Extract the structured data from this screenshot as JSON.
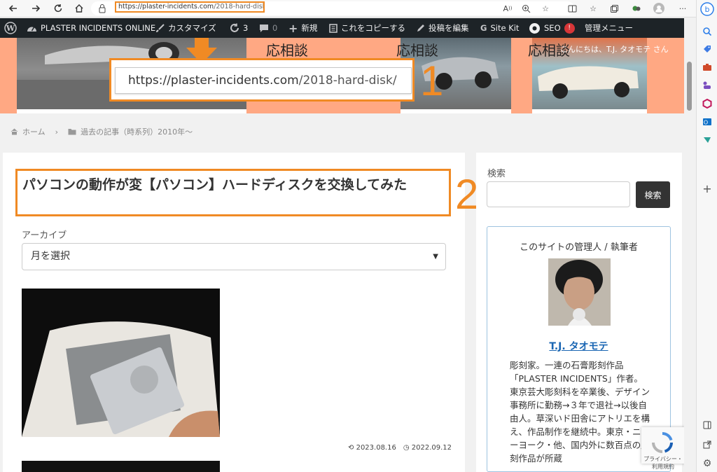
{
  "browser": {
    "url_host": "https://plaster-incidents.com",
    "url_path": "/2018-hard-disk/"
  },
  "admin_bar": {
    "site_name": "PLASTER INCIDENTS ONLINE",
    "customize": "カスタマイズ",
    "updates_count": "3",
    "comments_count": "0",
    "new": "新規",
    "copy": "これをコピーする",
    "edit_post": "投稿を編集",
    "site_kit": "Site Kit",
    "seo": "SEO",
    "seo_badge": "!",
    "admin_menu": "管理メニュー",
    "greeting": "こんにちは、T.J. タオモテ さん"
  },
  "banner": {
    "sodan": "応相談"
  },
  "annotations": {
    "url_big_host": "https://plaster-incidents.com",
    "url_big_path": "/2018-hard-disk/",
    "marker_1": "1",
    "marker_2": "2",
    "accent": "#f08a24"
  },
  "breadcrumb": {
    "home": "ホーム",
    "category": "過去の記事（時系列）2010年〜"
  },
  "post": {
    "title": "パソコンの動作が変【パソコン】ハードディスクを交換してみた",
    "archive_label": "アーカイブ",
    "archive_select": "月を選択",
    "updated": "2023.08.16",
    "published": "2022.09.12"
  },
  "sidebar": {
    "search_label": "検索",
    "search_button": "検索",
    "profile_heading": "このサイトの管理人 / 執筆者",
    "author_name": "T.J. タオモテ",
    "author_bio": "彫刻家。一連の石膏彫刻作品「PLASTER INCIDENTS」作者。東京芸大彫刻科を卒業後、デザイン事務所に勤務→３年で退社→以後自由人。草深いド田舎にアトリエを構え、作品制作を継続中。東京・ニューヨーク・他、国内外に数百点の彫刻作品が所蔵"
  },
  "recaptcha": {
    "text": "プライバシー・利用規約"
  }
}
